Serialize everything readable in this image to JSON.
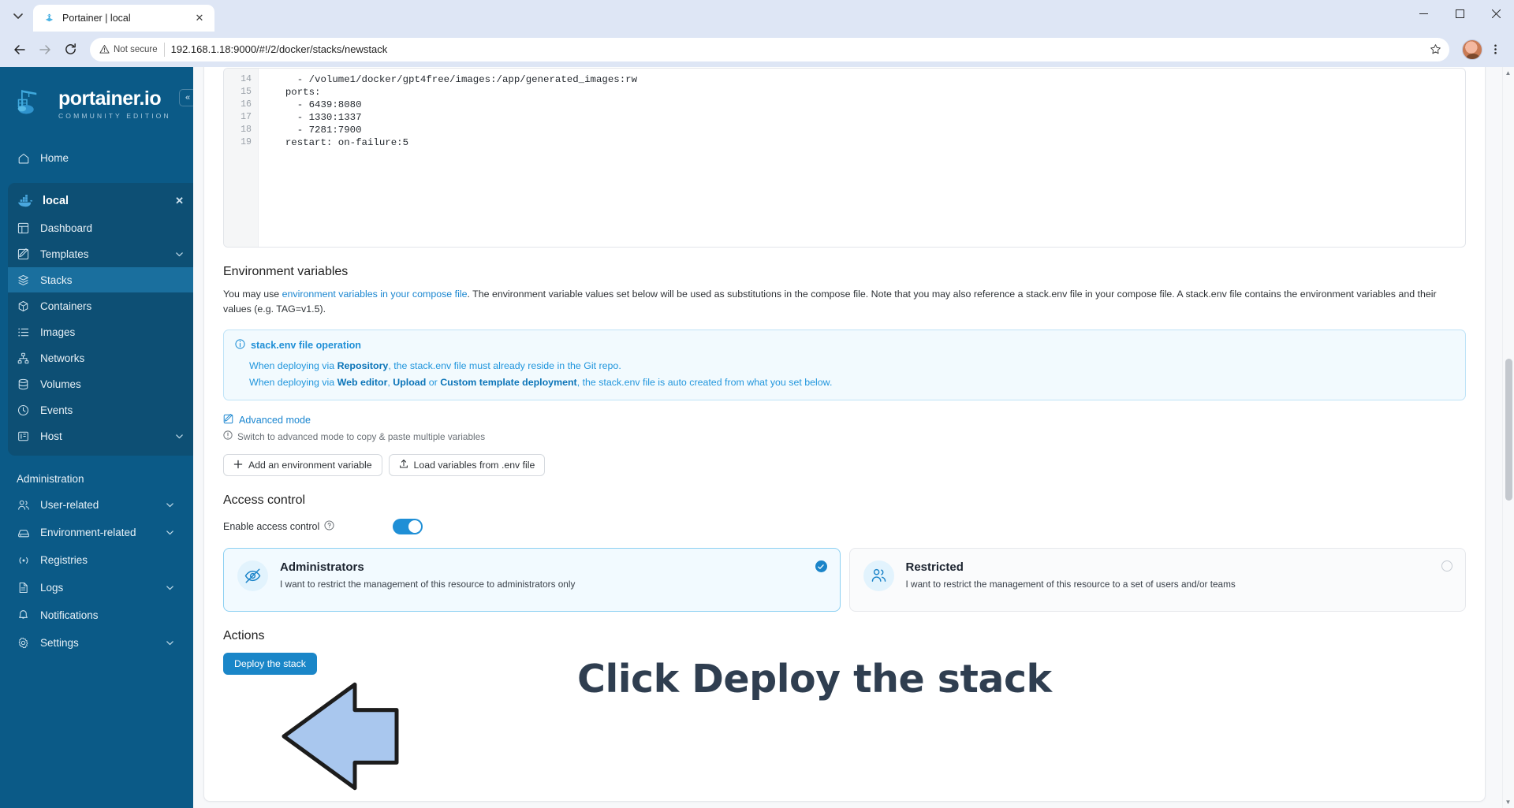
{
  "browser": {
    "tab": {
      "title": "Portainer | local",
      "favicon": "portainer-icon",
      "close_label": "✕"
    },
    "tab_list_icon": "chevron-down-icon",
    "window_controls": {
      "minimize": "─",
      "maximize": "☐",
      "close": "✕"
    },
    "nav": {
      "back": "←",
      "forward": "→",
      "reload": "↻"
    },
    "omnibox": {
      "security_label": "Not secure",
      "security_icon": "warning-triangle-icon",
      "url": "192.168.1.18:9000/#!/2/docker/stacks/newstack",
      "bookmark_icon": "star-icon"
    },
    "menu_icon": "kebab-menu-icon",
    "profile_icon": "avatar"
  },
  "sidebar": {
    "brand": {
      "name": "portainer.io",
      "edition": "COMMUNITY EDITION",
      "logo": "portainer-logo"
    },
    "collapse_icon": "«",
    "home": {
      "label": "Home",
      "icon": "home-icon"
    },
    "environment": {
      "label": "local",
      "icon": "docker-icon",
      "close_icon": "✕"
    },
    "env_items": [
      {
        "label": "Dashboard",
        "icon": "dashboard-icon",
        "chevron": false,
        "active": false
      },
      {
        "label": "Templates",
        "icon": "templates-icon",
        "chevron": true,
        "active": false
      },
      {
        "label": "Stacks",
        "icon": "stacks-icon",
        "chevron": false,
        "active": true
      },
      {
        "label": "Containers",
        "icon": "containers-icon",
        "chevron": false,
        "active": false
      },
      {
        "label": "Images",
        "icon": "images-icon",
        "chevron": false,
        "active": false
      },
      {
        "label": "Networks",
        "icon": "networks-icon",
        "chevron": false,
        "active": false
      },
      {
        "label": "Volumes",
        "icon": "volumes-icon",
        "chevron": false,
        "active": false
      },
      {
        "label": "Events",
        "icon": "events-icon",
        "chevron": false,
        "active": false
      },
      {
        "label": "Host",
        "icon": "host-icon",
        "chevron": true,
        "active": false
      }
    ],
    "admin_label": "Administration",
    "admin_items": [
      {
        "label": "User-related",
        "icon": "users-icon",
        "chevron": true
      },
      {
        "label": "Environment-related",
        "icon": "environment-icon",
        "chevron": true
      },
      {
        "label": "Registries",
        "icon": "registries-icon",
        "chevron": false
      },
      {
        "label": "Logs",
        "icon": "logs-icon",
        "chevron": true
      },
      {
        "label": "Notifications",
        "icon": "bell-icon",
        "chevron": false
      },
      {
        "label": "Settings",
        "icon": "gear-icon",
        "chevron": true
      }
    ]
  },
  "editor": {
    "lines": [
      {
        "no": "14",
        "text": "    - /volume1/docker/gpt4free/images:/app/generated_images:rw"
      },
      {
        "no": "15",
        "text": "  ports:"
      },
      {
        "no": "16",
        "text": "    - 6439:8080"
      },
      {
        "no": "17",
        "text": "    - 1330:1337"
      },
      {
        "no": "18",
        "text": "    - 7281:7900"
      },
      {
        "no": "19",
        "text": "  restart: on-failure:5"
      }
    ]
  },
  "env_section": {
    "title": "Environment variables",
    "desc_part1": "You may use ",
    "desc_link": "environment variables in your compose file",
    "desc_part2": ". The environment variable values set below will be used as substitutions in the compose file. Note that you may also reference a stack.env file in your compose file. A stack.env file contains the environment variables and their values (e.g. TAG=v1.5).",
    "info": {
      "icon": "info-circle-icon",
      "title": "stack.env file operation",
      "line1_a": "When deploying via ",
      "line1_b": "Repository",
      "line1_c": ", the stack.env file must already reside in the Git repo.",
      "line2_a": "When deploying via ",
      "line2_b": "Web editor",
      "line2_c": ", ",
      "line2_d": "Upload",
      "line2_e": " or ",
      "line2_f": "Custom template deployment",
      "line2_g": ", the stack.env file is auto created from what you set below."
    },
    "advanced": {
      "icon": "edit-icon",
      "label": "Advanced mode",
      "hint_icon": "info-circle-icon",
      "hint": "Switch to advanced mode to copy & paste multiple variables"
    },
    "buttons": [
      {
        "label": "Add an environment variable",
        "icon": "plus-icon"
      },
      {
        "label": "Load variables from .env file",
        "icon": "upload-icon"
      }
    ]
  },
  "access_control": {
    "title": "Access control",
    "toggle_label": "Enable access control",
    "toggle_help_icon": "question-circle-icon",
    "toggle_on": true,
    "options": [
      {
        "title": "Administrators",
        "desc": "I want to restrict the management of this resource to administrators only",
        "icon": "eye-off-icon",
        "selected": true
      },
      {
        "title": "Restricted",
        "desc": "I want to restrict the management of this resource to a set of users and/or teams",
        "icon": "users-icon",
        "selected": false
      }
    ]
  },
  "actions": {
    "title": "Actions",
    "deploy_label": "Deploy the stack"
  },
  "annotation": {
    "text": "Click Deploy the stack",
    "arrow": "left-arrow-annotation",
    "arrow_fill": "#a9c7ee",
    "arrow_stroke": "#1c1c1c",
    "text_color": "#2f3e50"
  },
  "colors": {
    "sidebar_bg": "#0b5a87",
    "sidebar_group_bg": "#0d4f74",
    "sidebar_active": "#1a6f9e",
    "accent": "#1a86c8",
    "info_bg": "#f2fafe",
    "info_border": "#bfe3f7"
  }
}
